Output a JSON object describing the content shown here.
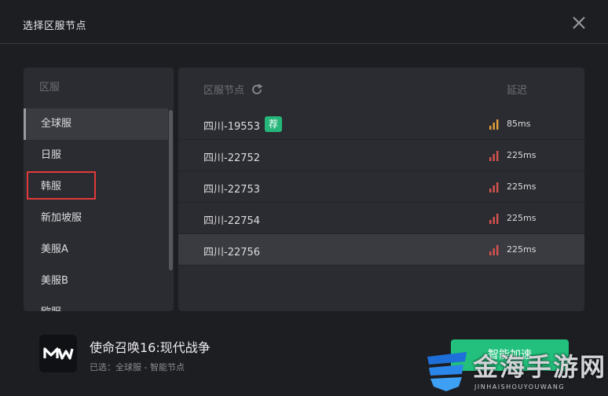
{
  "window": {
    "title": "选择区服节点"
  },
  "regions": {
    "header": "区服",
    "items": [
      {
        "label": "全球服",
        "active": true
      },
      {
        "label": "日服"
      },
      {
        "label": "韩服"
      },
      {
        "label": "新加坡服"
      },
      {
        "label": "美服A"
      },
      {
        "label": "美服B"
      },
      {
        "label": "欧服"
      }
    ]
  },
  "nodes": {
    "header": "区服节点",
    "latency_header": "延迟",
    "badge": "荐",
    "rows": [
      {
        "name": "四川-19553",
        "latency": "85ms",
        "signal_color": "#e6a23c",
        "recommended": true
      },
      {
        "name": "四川-22752",
        "latency": "225ms",
        "signal_color": "#d9534f"
      },
      {
        "name": "四川-22753",
        "latency": "225ms",
        "signal_color": "#d9534f"
      },
      {
        "name": "四川-22754",
        "latency": "225ms",
        "signal_color": "#d9534f"
      },
      {
        "name": "四川-22756",
        "latency": "225ms",
        "signal_color": "#d9534f",
        "selected": true
      }
    ]
  },
  "game": {
    "title": "使命召唤16:现代战争",
    "selected_info": "已选：全球服 - 智能节点"
  },
  "accelerate_button": "智能加速",
  "watermark": {
    "text": "金海手游网",
    "sub": "JINHAISHOUYOUWANG"
  },
  "colors": {
    "accent": "#22c07c",
    "badge": "#27b67a",
    "highlight": "#e03a3a"
  }
}
